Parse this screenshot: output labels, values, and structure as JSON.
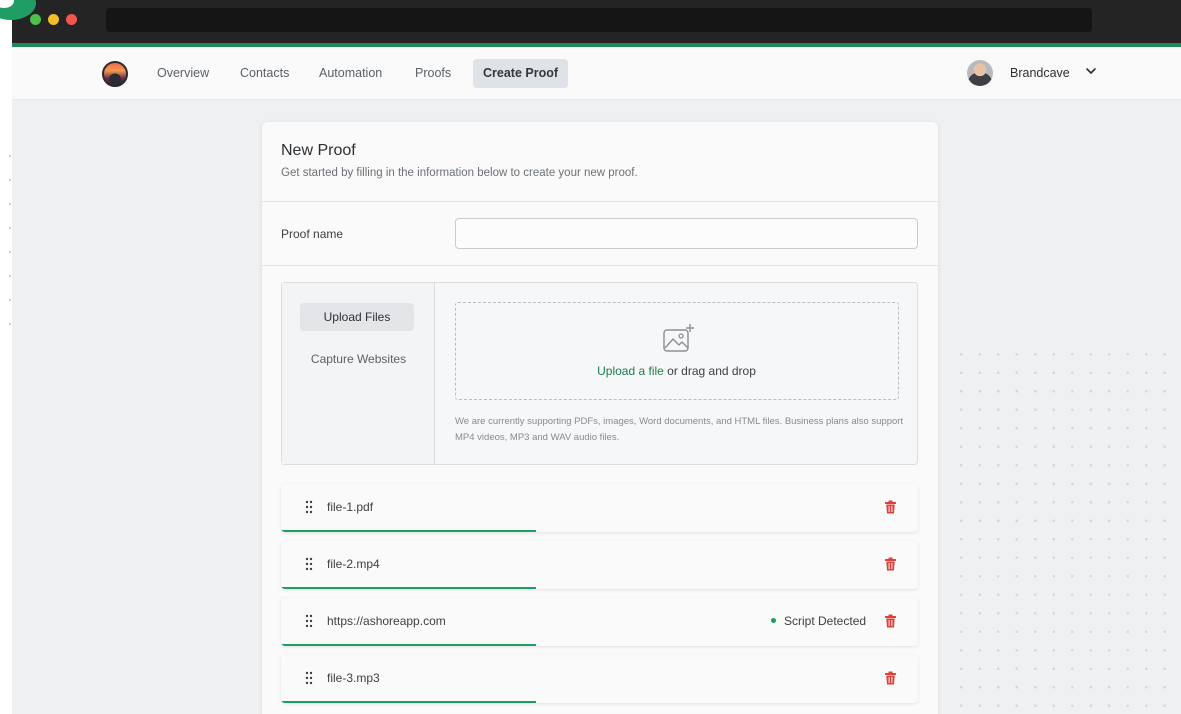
{
  "colors": {
    "accent": "#1f9e63",
    "danger": "#e0403a",
    "link": "#1b7f4c"
  },
  "nav": {
    "items": [
      {
        "label": "Overview"
      },
      {
        "label": "Contacts"
      },
      {
        "label": "Automation"
      },
      {
        "label": "Proofs"
      },
      {
        "label": "Create Proof",
        "active": true
      }
    ],
    "user_name": "Brandcave"
  },
  "card": {
    "title": "New Proof",
    "subtitle": "Get started by filling in the information below to create your new proof.",
    "proof_name_label": "Proof name",
    "proof_name_value": ""
  },
  "upload": {
    "tabs": [
      {
        "label": "Upload Files",
        "active": true
      },
      {
        "label": "Capture Websites"
      }
    ],
    "link_text": "Upload a file",
    "drop_text": " or drag and drop",
    "support_note": "We are currently supporting PDFs, images, Word documents, and HTML files. Business plans also support MP4 videos, MP3 and WAV audio files.",
    "icon": "image-plus-icon"
  },
  "files": [
    {
      "name": "file-1.pdf",
      "progress_pct": 40,
      "status": ""
    },
    {
      "name": "file-2.mp4",
      "progress_pct": 40,
      "status": ""
    },
    {
      "name": "https://ashoreapp.com",
      "progress_pct": 40,
      "status": "Script Detected"
    },
    {
      "name": "file-3.mp3",
      "progress_pct": 40,
      "status": ""
    }
  ]
}
